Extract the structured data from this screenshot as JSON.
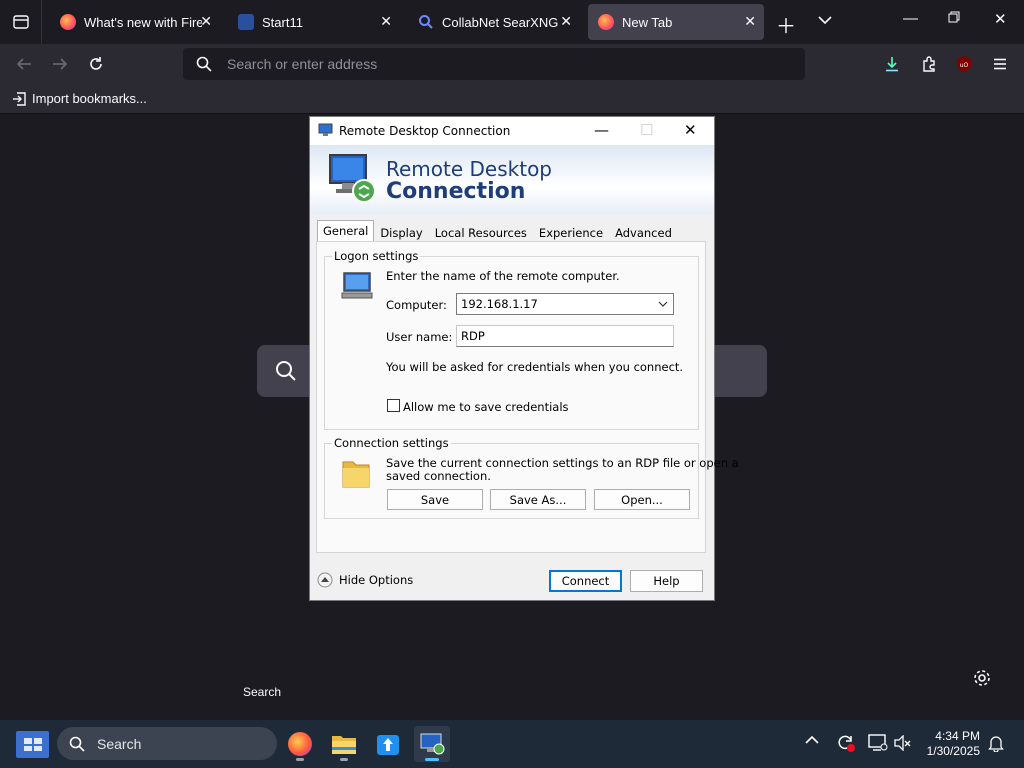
{
  "browser": {
    "tabs": [
      {
        "title": "What's new with Firefo",
        "favicon": "firefox-icon"
      },
      {
        "title": "Start11",
        "favicon": "start11-icon"
      },
      {
        "title": "CollabNet SearXNG",
        "favicon": "search-icon"
      },
      {
        "title": "New Tab",
        "favicon": "firefox-icon",
        "active": true
      }
    ],
    "url_placeholder": "Search or enter address",
    "import_bookmarks": "Import bookmarks...",
    "tooltip": "Search"
  },
  "dialog": {
    "title": "Remote Desktop Connection",
    "banner_line1": "Remote Desktop",
    "banner_line2": "Connection",
    "tabs": [
      "General",
      "Display",
      "Local Resources",
      "Experience",
      "Advanced"
    ],
    "logon": {
      "group_title": "Logon settings",
      "intro": "Enter the name of the remote computer.",
      "computer_label": "Computer:",
      "computer_value": "192.168.1.17",
      "username_label": "User name:",
      "username_value": "RDP",
      "note": "You will be asked for credentials when you connect.",
      "save_creds_label": "Allow me to save credentials",
      "save_creds_checked": false
    },
    "connection": {
      "group_title": "Connection settings",
      "desc_line1": "Save the current connection settings to an RDP file or open a",
      "desc_line2": "saved connection.",
      "save": "Save",
      "save_as": "Save As...",
      "open": "Open..."
    },
    "hide_options": "Hide Options",
    "connect": "Connect",
    "help": "Help"
  },
  "taskbar": {
    "search_label": "Search",
    "time": "4:34 PM",
    "date": "1/30/2025",
    "apps": [
      "firefox-icon",
      "file-explorer-icon",
      "store-icon",
      "remote-desktop-icon"
    ]
  },
  "colors": {
    "browser_bg": "#1c1b22",
    "toolbar": "#2b2a33",
    "accent": "#0078d7",
    "banner_text": "#1e3d7a"
  }
}
